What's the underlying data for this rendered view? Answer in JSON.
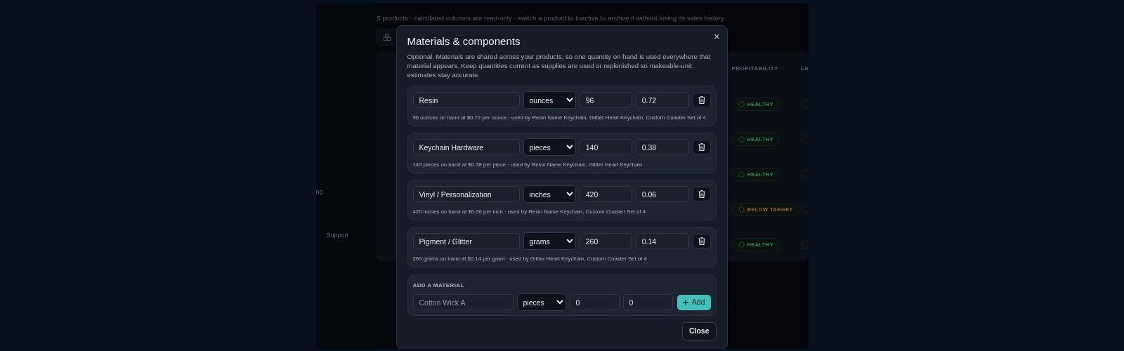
{
  "background": {
    "subtitle": "5 products · calculated columns are read-only · switch a product to Inactive to archive it without losing its sales history",
    "sidebar": [
      {
        "label": "ng"
      },
      {
        "label": "Support"
      }
    ],
    "table": {
      "columns": [
        "PROFITABILITY",
        "LA"
      ],
      "rows": [
        {
          "profitability": "HEALTHY",
          "color": "#2f8a60"
        },
        {
          "profitability": "HEALTHY",
          "color": "#2f8a60"
        },
        {
          "profitability": "HEALTHY",
          "color": "#2f8a60"
        },
        {
          "profitability": "BELOW TARGET",
          "color": "#9a6420"
        },
        {
          "profitability": "HEALTHY",
          "color": "#2f8a60"
        }
      ]
    }
  },
  "modal": {
    "title": "Materials & components",
    "close_symbol": "×",
    "description": "Optional. Materials are shared across your products, so one quantity on hand is used everywhere that material appears. Keep quantities current as supplies are used or replenished so makeable-unit estimates stay accurate.",
    "materials": [
      {
        "name": "Resin",
        "unit": "ounces",
        "quantity": "96",
        "cost": "0.72",
        "summary": "96 ounces on hand at $0.72 per ounce · used by Resin Name Keychain, Glitter Heart Keychain, Custom Coaster Set of 4"
      },
      {
        "name": "Keychain Hardware",
        "unit": "pieces",
        "quantity": "140",
        "cost": "0.38",
        "summary": "140 pieces on hand at $0.38 per piece · used by Resin Name Keychain, Glitter Heart Keychain"
      },
      {
        "name": "Vinyl / Personalization",
        "unit": "inches",
        "quantity": "420",
        "cost": "0.06",
        "summary": "420 inches on hand at $0.06 per inch · used by Resin Name Keychain, Custom Coaster Set of 4"
      },
      {
        "name": "Pigment / Glitter",
        "unit": "grams",
        "quantity": "260",
        "cost": "0.14",
        "summary": "260 grams on hand at $0.14 per gram · used by Glitter Heart Keychain, Custom Coaster Set of 4"
      }
    ],
    "add_material": {
      "heading": "ADD A MATERIAL",
      "name": {
        "placeholder": "Cotton Wick A"
      },
      "unit": "pieces",
      "quantity": "0",
      "cost": "0",
      "button": "Add"
    },
    "close_button": "Close"
  }
}
